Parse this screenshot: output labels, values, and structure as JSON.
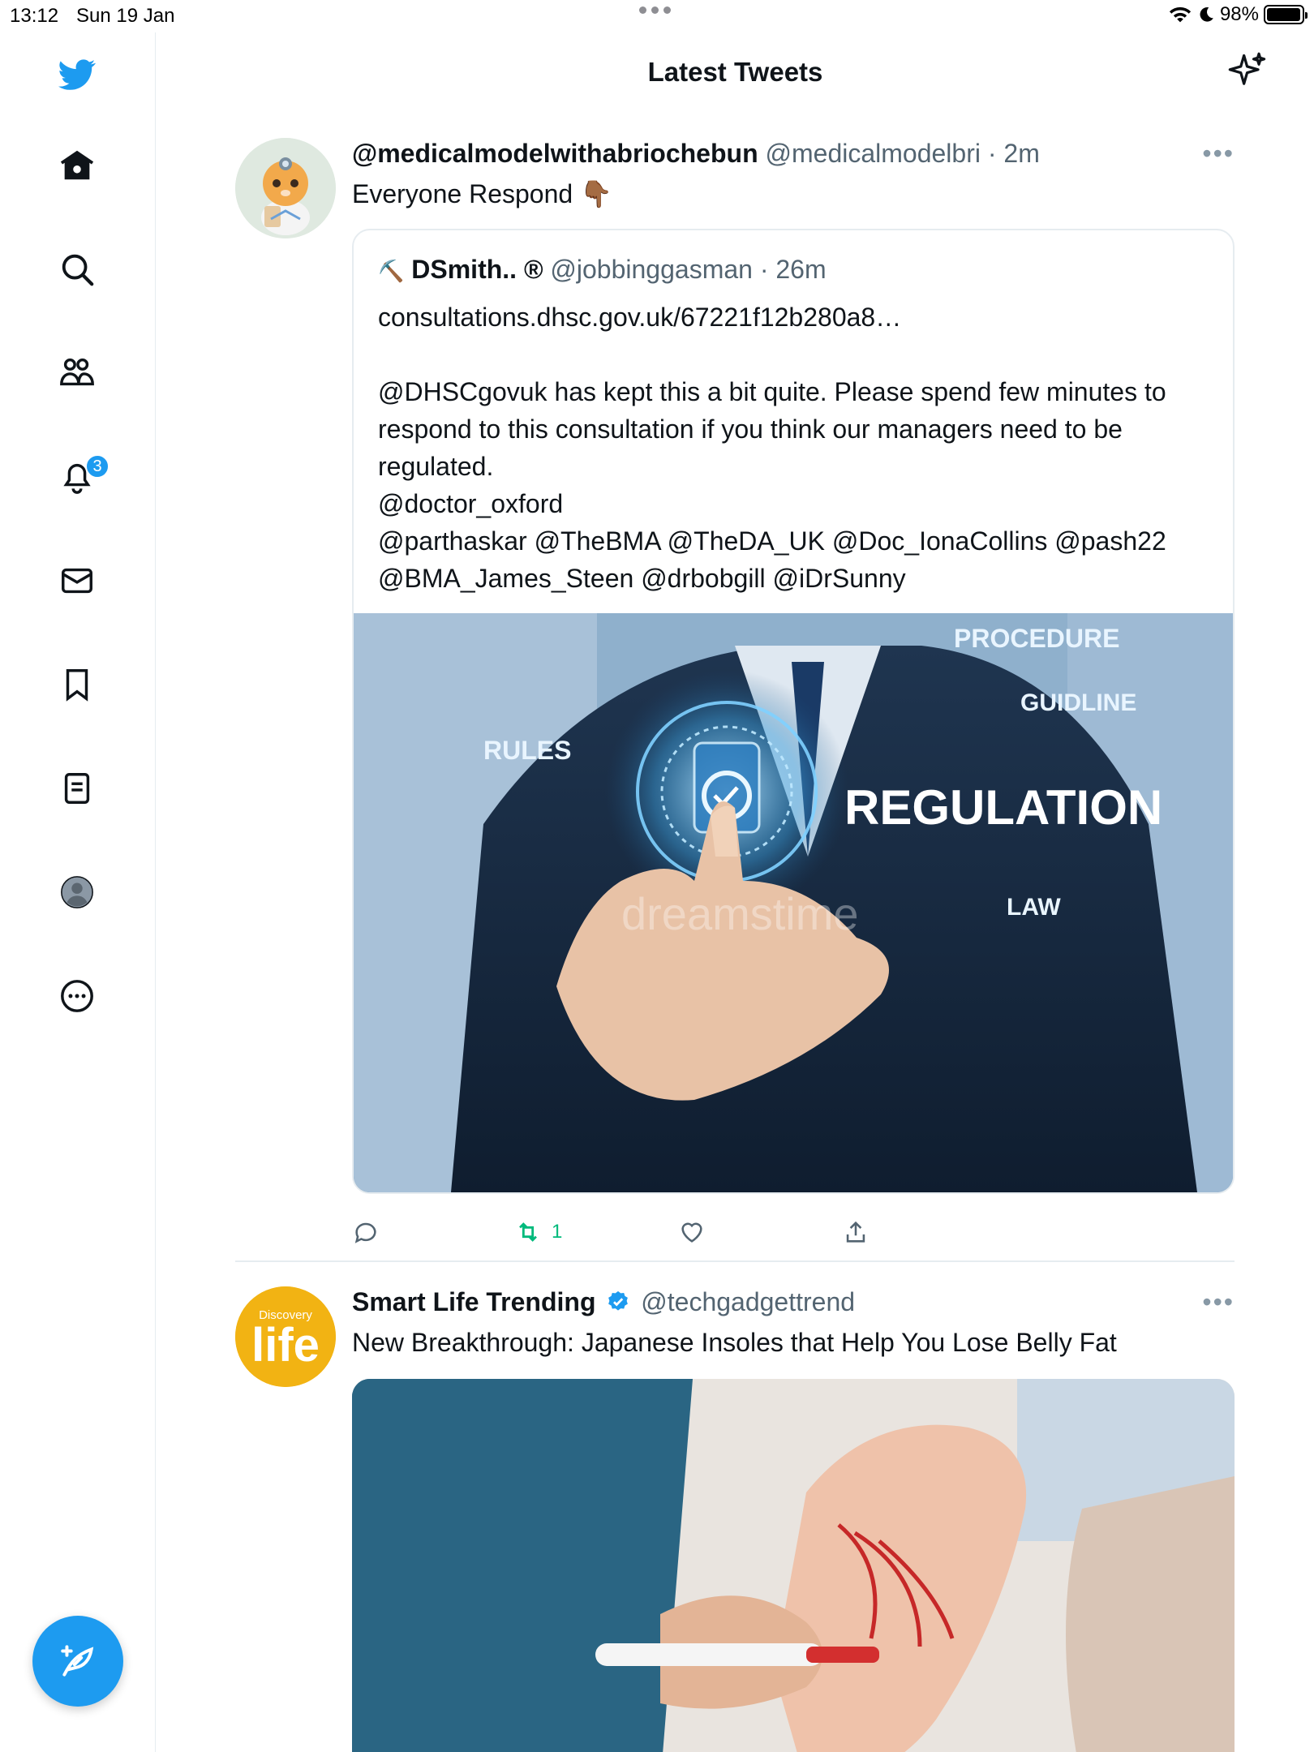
{
  "status_bar": {
    "time": "13:12",
    "date": "Sun 19 Jan",
    "battery": "98%",
    "battery_level": 0.98
  },
  "header": {
    "title": "Latest Tweets"
  },
  "sidebar": {
    "notifications_badge": "3",
    "items": [
      "twitter-logo",
      "home-icon",
      "search-icon",
      "communities-icon",
      "notifications-icon",
      "messages-icon",
      "bookmark-icon",
      "lists-icon",
      "profile-icon",
      "more-icon"
    ]
  },
  "tweets": [
    {
      "name": "@medicalmodelwithabriochebun",
      "handle": "@medicalmodelbri",
      "time": "· 2m",
      "text": "Everyone Respond 👇🏾",
      "quote": {
        "name": "DSmith..",
        "emoji": "⛏️",
        "registered": "®",
        "handle": "@jobbinggasman",
        "time": "· 26m",
        "text": "consultations.dhsc.gov.uk/67221f12b280a8…\n\n@DHSCgovuk has kept this a bit quite. Please spend few minutes to respond to this consultation if you think our managers need to be regulated.\n@doctor_oxford\n@parthaskar @TheBMA @TheDA_UK @Doc_IonaCollins @pash22\n@BMA_James_Steen @drbobgill @iDrSunny",
        "image_labels": {
          "procedure": "PROCEDURE",
          "guidline": "GUIDLINE",
          "rules": "RULES",
          "regulation": "REGULATION",
          "law": "LAW",
          "watermark": "dreamstime"
        }
      },
      "retweet_count": "1"
    },
    {
      "name": "Smart Life Trending",
      "handle": "@techgadgettrend",
      "text": "New Breakthrough: Japanese Insoles that Help You Lose Belly Fat",
      "avatar_text": {
        "top": "Discovery",
        "main": "life"
      }
    }
  ],
  "colors": {
    "accent": "#1d9bf0",
    "retweet": "#00ba7c",
    "secondary_text": "#536471"
  }
}
